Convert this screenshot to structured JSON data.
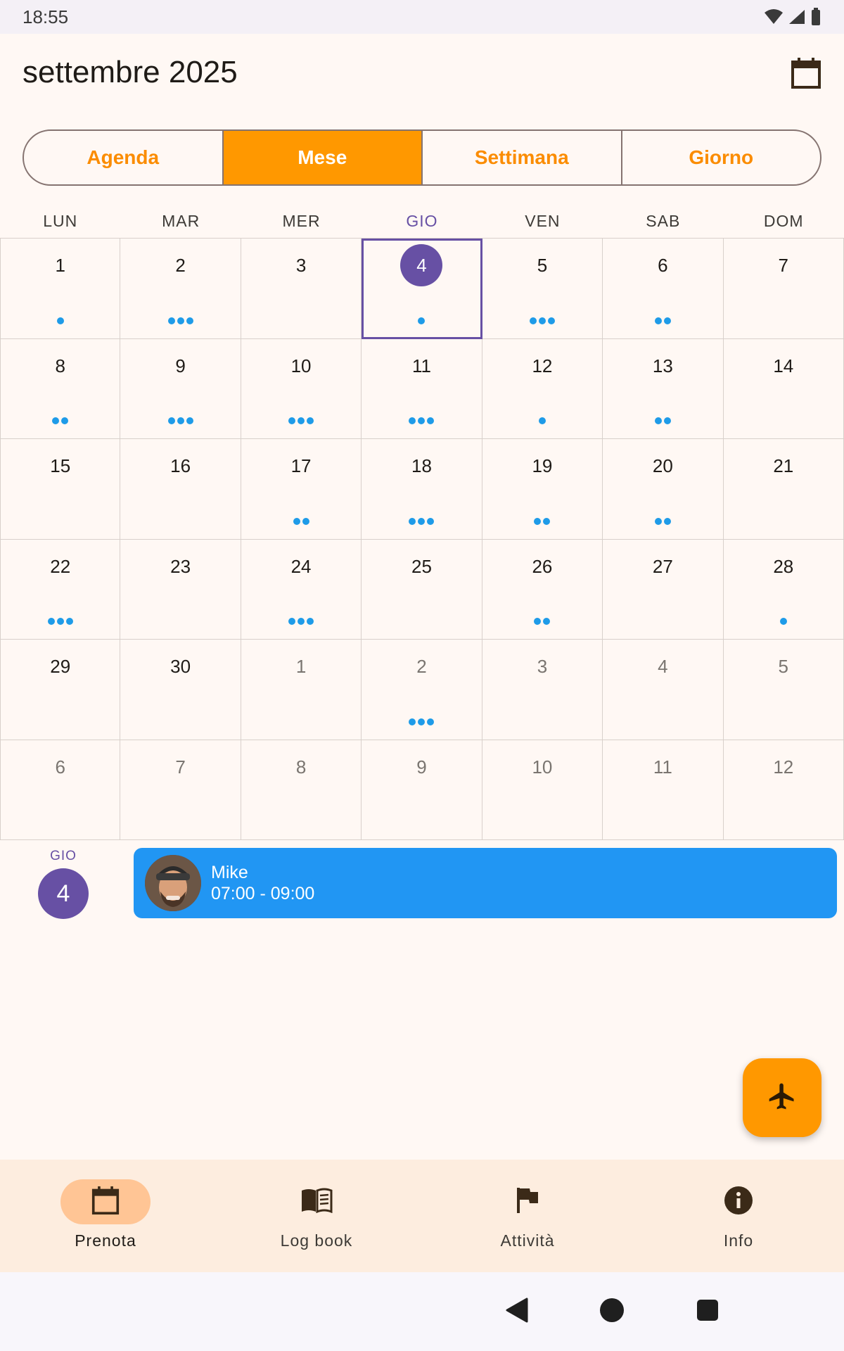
{
  "status_bar": {
    "time": "18:55"
  },
  "header": {
    "title": "settembre 2025"
  },
  "view_tabs": [
    {
      "label": "Agenda",
      "active": false
    },
    {
      "label": "Mese",
      "active": true
    },
    {
      "label": "Settimana",
      "active": false
    },
    {
      "label": "Giorno",
      "active": false
    }
  ],
  "weekdays": [
    "LUN",
    "MAR",
    "MER",
    "GIO",
    "VEN",
    "SAB",
    "DOM"
  ],
  "today_weekday_index": 3,
  "days": [
    {
      "n": "1",
      "dots": 1,
      "other": false
    },
    {
      "n": "2",
      "dots": 3,
      "other": false
    },
    {
      "n": "3",
      "dots": 0,
      "other": false
    },
    {
      "n": "4",
      "dots": 1,
      "other": false,
      "selected": true
    },
    {
      "n": "5",
      "dots": 3,
      "other": false
    },
    {
      "n": "6",
      "dots": 2,
      "other": false
    },
    {
      "n": "7",
      "dots": 0,
      "other": false
    },
    {
      "n": "8",
      "dots": 2,
      "other": false
    },
    {
      "n": "9",
      "dots": 3,
      "other": false
    },
    {
      "n": "10",
      "dots": 3,
      "other": false
    },
    {
      "n": "11",
      "dots": 3,
      "other": false
    },
    {
      "n": "12",
      "dots": 1,
      "other": false
    },
    {
      "n": "13",
      "dots": 2,
      "other": false
    },
    {
      "n": "14",
      "dots": 0,
      "other": false
    },
    {
      "n": "15",
      "dots": 0,
      "other": false
    },
    {
      "n": "16",
      "dots": 0,
      "other": false
    },
    {
      "n": "17",
      "dots": 2,
      "other": false
    },
    {
      "n": "18",
      "dots": 3,
      "other": false
    },
    {
      "n": "19",
      "dots": 2,
      "other": false
    },
    {
      "n": "20",
      "dots": 2,
      "other": false
    },
    {
      "n": "21",
      "dots": 0,
      "other": false
    },
    {
      "n": "22",
      "dots": 3,
      "other": false
    },
    {
      "n": "23",
      "dots": 0,
      "other": false
    },
    {
      "n": "24",
      "dots": 3,
      "other": false
    },
    {
      "n": "25",
      "dots": 0,
      "other": false
    },
    {
      "n": "26",
      "dots": 2,
      "other": false
    },
    {
      "n": "27",
      "dots": 0,
      "other": false
    },
    {
      "n": "28",
      "dots": 1,
      "other": false
    },
    {
      "n": "29",
      "dots": 0,
      "other": false
    },
    {
      "n": "30",
      "dots": 0,
      "other": false
    },
    {
      "n": "1",
      "dots": 0,
      "other": true
    },
    {
      "n": "2",
      "dots": 3,
      "other": true
    },
    {
      "n": "3",
      "dots": 0,
      "other": true
    },
    {
      "n": "4",
      "dots": 0,
      "other": true
    },
    {
      "n": "5",
      "dots": 0,
      "other": true
    },
    {
      "n": "6",
      "dots": 0,
      "other": true
    },
    {
      "n": "7",
      "dots": 0,
      "other": true
    },
    {
      "n": "8",
      "dots": 0,
      "other": true
    },
    {
      "n": "9",
      "dots": 0,
      "other": true
    },
    {
      "n": "10",
      "dots": 0,
      "other": true
    },
    {
      "n": "11",
      "dots": 0,
      "other": true
    },
    {
      "n": "12",
      "dots": 0,
      "other": true
    }
  ],
  "selected_day": {
    "weekday": "GIO",
    "day": "4",
    "events": [
      {
        "name": "Mike",
        "time": "07:00 - 09:00"
      }
    ]
  },
  "bottom_nav": [
    {
      "label": "Prenota",
      "icon": "calendar-icon",
      "active": true
    },
    {
      "label": "Log book",
      "icon": "book-icon",
      "active": false
    },
    {
      "label": "Attività",
      "icon": "flag-icon",
      "active": false
    },
    {
      "label": "Info",
      "icon": "info-icon",
      "active": false
    }
  ],
  "colors": {
    "accent": "#ff9800",
    "today": "#6750a4",
    "event": "#2196f3",
    "dot": "#1e9be8"
  }
}
